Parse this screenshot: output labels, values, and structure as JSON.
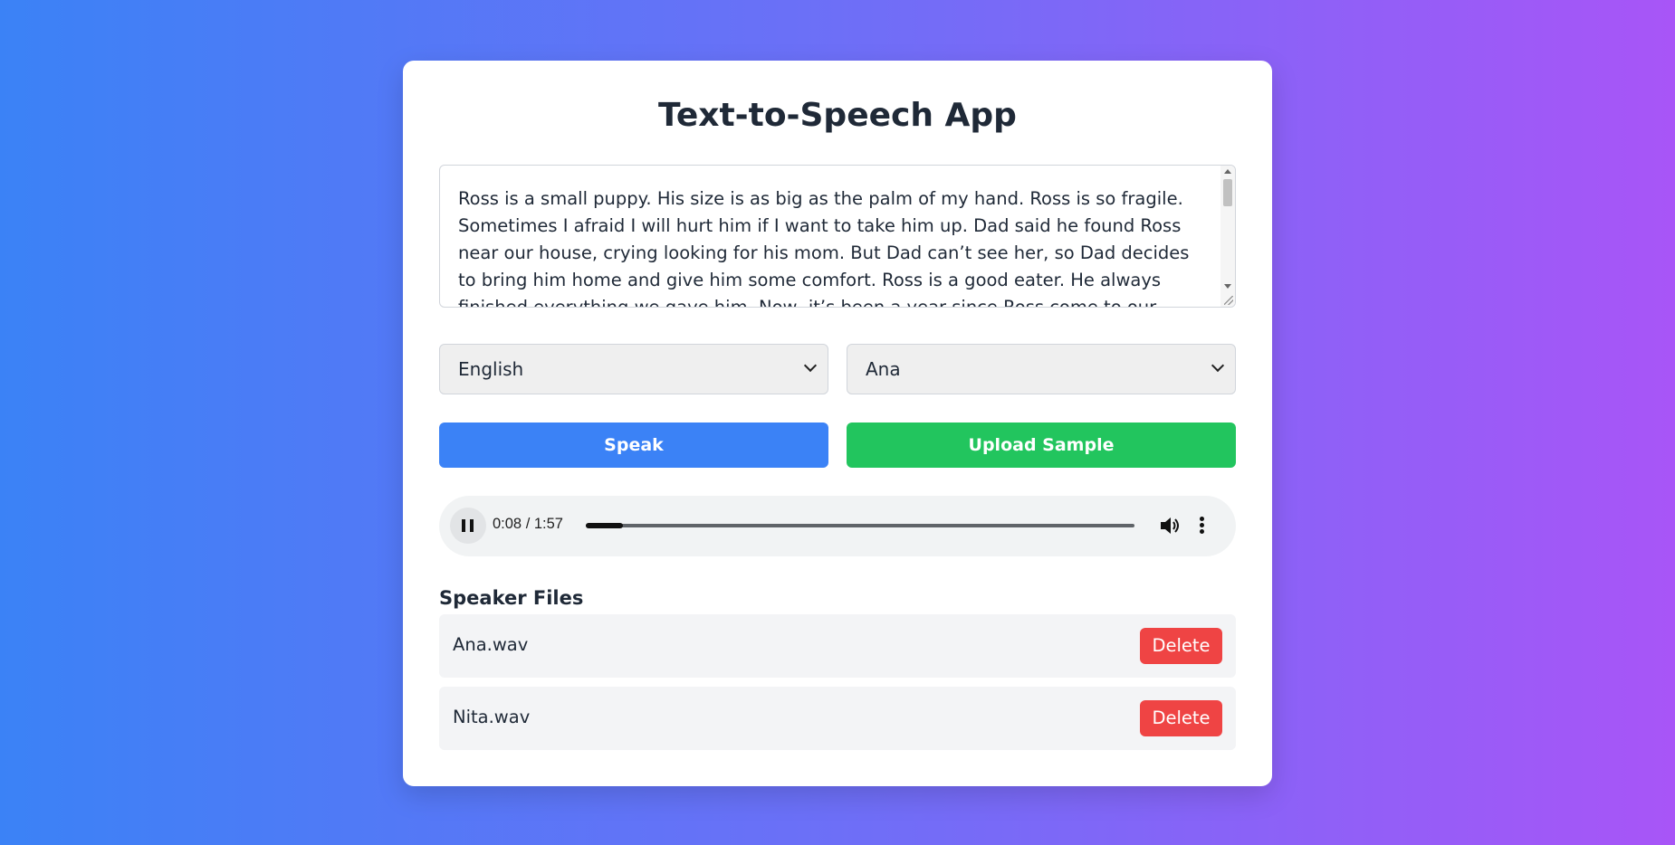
{
  "app": {
    "title": "Text-to-Speech App"
  },
  "text_input": {
    "value": "Ross is a small puppy. His size is as big as the palm of my hand. Ross is so fragile. Sometimes I afraid I will hurt him if I want to take him up. Dad said he found Ross near our house, crying looking for his mom. But Dad can’t see her, so Dad decides to bring him home and give him some comfort. Ross is a good eater. He always finished everything we gave him. Now, it’s been a year since Ross come to our family. His small body has grown up into a"
  },
  "language_select": {
    "selected": "English"
  },
  "voice_select": {
    "selected": "Ana"
  },
  "buttons": {
    "speak": "Speak",
    "upload": "Upload Sample"
  },
  "audio_player": {
    "time": "0:08 / 1:57",
    "progress": 0.068
  },
  "speaker_files": {
    "title": "Speaker Files",
    "files": [
      {
        "name": "Ana.wav",
        "delete_label": "Delete"
      },
      {
        "name": "Nita.wav",
        "delete_label": "Delete"
      }
    ]
  },
  "colors": {
    "gradient_start": "#3b82f6",
    "gradient_end": "#a855f7",
    "speak_button": "#3b82f6",
    "upload_button": "#22c55e",
    "delete_button": "#ef4444"
  }
}
